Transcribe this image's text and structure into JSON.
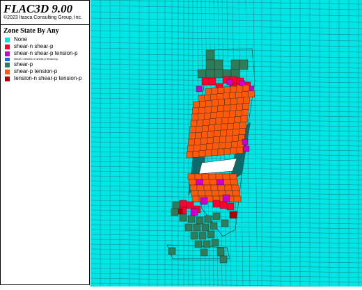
{
  "app": {
    "title": "FLAC3D 9.00",
    "copyright": "©2023 Itasca Consulting Group, Inc."
  },
  "legend": {
    "title": "Zone State By Any",
    "items": [
      {
        "label": "None",
        "color": "#00e5e5"
      },
      {
        "label": "shear-n shear-p",
        "color": "#ff0033"
      },
      {
        "label": "shear-n shear-p tension-p",
        "color": "#cc00cc"
      },
      {
        "label": "shear-n tension-n shear-p tension-p",
        "color": "#1a66e6",
        "small": true
      },
      {
        "label": "shear-p",
        "color": "#2e7d5a"
      },
      {
        "label": "shear-p tension-p",
        "color": "#ff5a0a"
      },
      {
        "label": "tension-n shear-p tension-p",
        "color": "#b00000"
      }
    ]
  },
  "viewport": {
    "background": "#00e5e5",
    "grid_color": "#1c8c8c"
  }
}
